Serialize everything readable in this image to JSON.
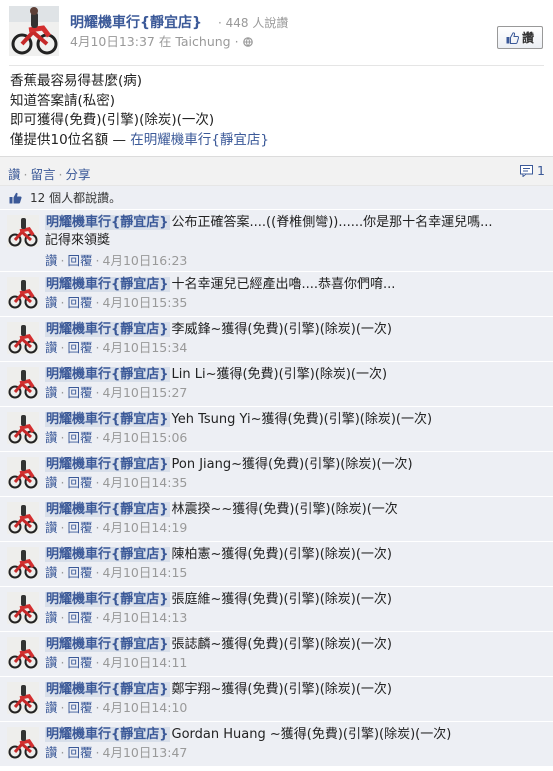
{
  "header": {
    "page_name": "明耀機車行{靜宜店}",
    "like_count": "· 448 人說讚",
    "post_meta": "4月10日13:37 在 Taichung · ",
    "like_button_label": "讚"
  },
  "post": {
    "lines": [
      "香蕉最容易得甚麼(病)",
      "知道答案請(私密)",
      "即可獲得(免費)(引擎)(除炭)(一次)",
      "僅提供10位名額 — "
    ],
    "location_prefix": "在",
    "location_link": "明耀機車行{靜宜店}"
  },
  "actions": {
    "like": "讚",
    "comment": "留言",
    "share": "分享",
    "comment_count": "1"
  },
  "likes_summary": "12 個人都說讚。",
  "comments": [
    {
      "author": "明耀機車行{靜宜店}",
      "text": "公布正確答案....((脊椎側彎))......你是那十名幸運兒嗎...",
      "text2": "記得來領獎",
      "like": "讚",
      "reply": "回覆",
      "time": "4月10日16:23"
    },
    {
      "author": "明耀機車行{靜宜店}",
      "text": "十名幸運兒已經產出嚕....恭喜你們唷...",
      "like": "讚",
      "reply": "回覆",
      "time": "4月10日15:35"
    },
    {
      "author": "明耀機車行{靜宜店}",
      "text": "李威鋒~獲得(免費)(引擎)(除炭)(一次)",
      "like": "讚",
      "reply": "回覆",
      "time": "4月10日15:34"
    },
    {
      "author": "明耀機車行{靜宜店}",
      "text": "Lin Li~獲得(免費)(引擎)(除炭)(一次)",
      "like": "讚",
      "reply": "回覆",
      "time": "4月10日15:27"
    },
    {
      "author": "明耀機車行{靜宜店}",
      "text": "Yeh Tsung Yi~獲得(免費)(引擎)(除炭)(一次)",
      "like": "讚",
      "reply": "回覆",
      "time": "4月10日15:06"
    },
    {
      "author": "明耀機車行{靜宜店}",
      "text": "Pon Jiang~獲得(免費)(引擎)(除炭)(一次)",
      "like": "讚",
      "reply": "回覆",
      "time": "4月10日14:35"
    },
    {
      "author": "明耀機車行{靜宜店}",
      "text": "林震揆~~獲得(免費)(引擎)(除炭)(一次",
      "like": "讚",
      "reply": "回覆",
      "time": "4月10日14:19"
    },
    {
      "author": "明耀機車行{靜宜店}",
      "text": "陳柏憲~獲得(免費)(引擎)(除炭)(一次)",
      "like": "讚",
      "reply": "回覆",
      "time": "4月10日14:15"
    },
    {
      "author": "明耀機車行{靜宜店}",
      "text": "張庭維~獲得(免費)(引擎)(除炭)(一次)",
      "like": "讚",
      "reply": "回覆",
      "time": "4月10日14:13"
    },
    {
      "author": "明耀機車行{靜宜店}",
      "text": "張誌麟~獲得(免費)(引擎)(除炭)(一次)",
      "like": "讚",
      "reply": "回覆",
      "time": "4月10日14:11"
    },
    {
      "author": "明耀機車行{靜宜店}",
      "text": "鄭宇翔~獲得(免費)(引擎)(除炭)(一次)",
      "like": "讚",
      "reply": "回覆",
      "time": "4月10日14:10"
    },
    {
      "author": "明耀機車行{靜宜店}",
      "text": "Gordan Huang ~獲得(免費)(引擎)(除炭)(一次)",
      "like": "讚",
      "reply": "回覆",
      "time": "4月10日13:47"
    }
  ],
  "colors": {
    "link": "#3b5998",
    "comment_bg": "#edeff4",
    "author_highlight": "#d8dfea",
    "meta_gray": "#999999"
  },
  "icons": [
    "motorcycle-avatar-icon",
    "globe-icon",
    "thumbs-up-icon",
    "comment-bubble-icon"
  ]
}
